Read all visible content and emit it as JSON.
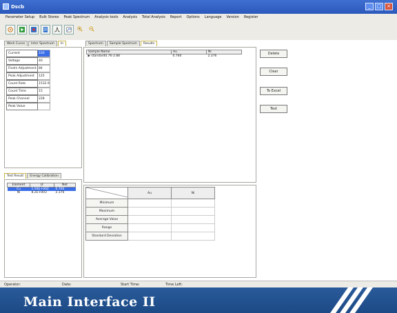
{
  "window": {
    "title": "Dscb"
  },
  "menu": [
    "Parameter Setup",
    "Bulk Stores",
    "Peak Spectrum",
    "Analysis tools",
    "Analysis",
    "Total Analysis",
    "Report",
    "Options",
    "Language",
    "Version",
    "Register"
  ],
  "left_tabs": [
    "Work Curve",
    "Inter Spectrum",
    "In"
  ],
  "params": [
    {
      "label": "Current",
      "value": "100"
    },
    {
      "label": "Voltage",
      "value": "40"
    },
    {
      "label": "FineIn Adjustment",
      "value": "84"
    },
    {
      "label": "Peak Adjustment",
      "value": "125"
    },
    {
      "label": "Count Rate",
      "value": "1532.9"
    },
    {
      "label": "Count Time",
      "value": "15"
    },
    {
      "label": "Peak Channel",
      "value": "228"
    },
    {
      "label": "Peak Value",
      "value": ""
    }
  ],
  "result_tabs": [
    "Test Result",
    "Energy Calibration"
  ],
  "element_table": {
    "headers": [
      "Element",
      "LF",
      "Net"
    ],
    "rows": [
      [
        "Cu",
        "1.56E+002",
        "0.760"
      ],
      [
        "Ni",
        "8.2E+003",
        "2.376"
      ]
    ]
  },
  "sample_tabs": [
    "Spectrum",
    "Sample Spectrum",
    "Results"
  ],
  "sample_table": {
    "headers": [
      "Sample Name",
      "Au",
      "Ni"
    ],
    "rows": [
      [
        "standard0.76-2.88",
        "0.760",
        "2.376"
      ]
    ]
  },
  "actions": {
    "delete": "Delete",
    "clear": "Clear",
    "to_excel": "To Excel",
    "test": "Test"
  },
  "stats": {
    "columns": [
      "Au",
      "Ni"
    ],
    "rows": [
      "Minimum",
      "Maximum",
      "Average Value",
      "Range",
      "Standard Deviation"
    ]
  },
  "status": {
    "operator": "Operator:",
    "date": "Date:",
    "start_time": "Start Time:",
    "time_left": "Time Left:"
  },
  "caption": "Main Interface II"
}
